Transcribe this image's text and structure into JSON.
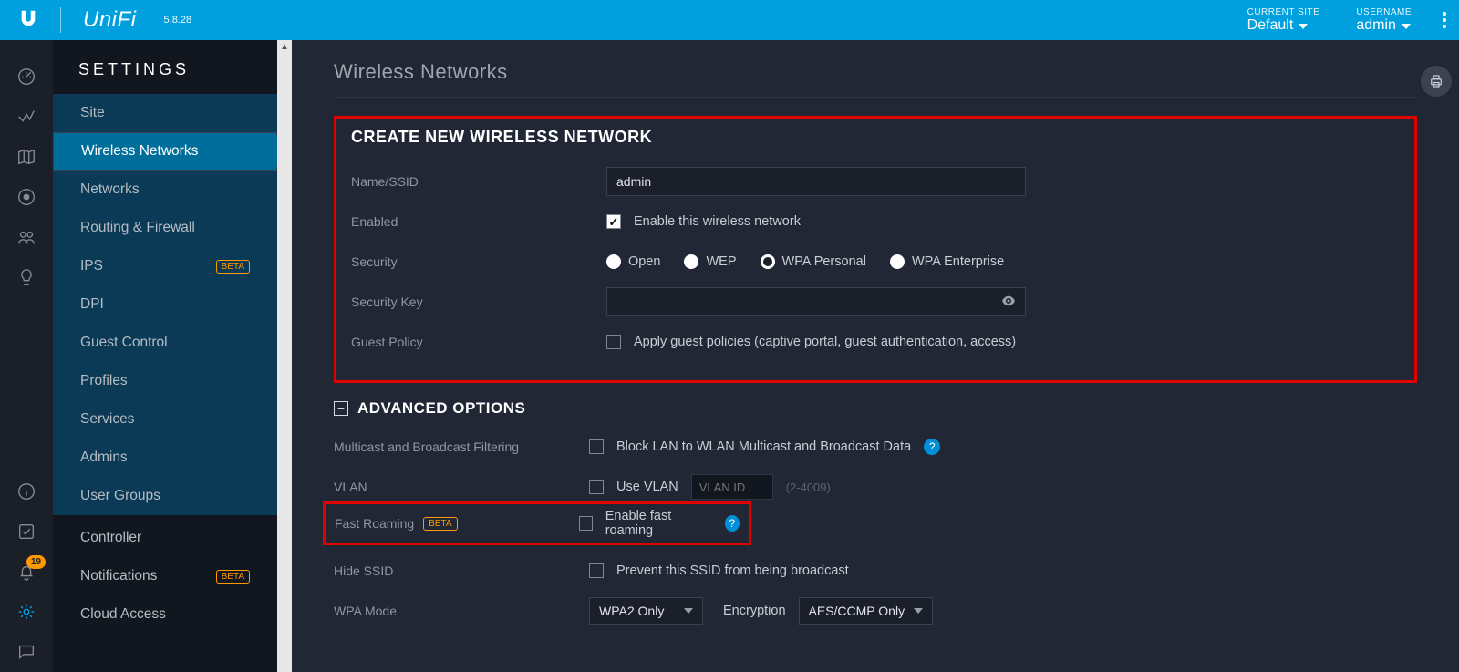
{
  "topbar": {
    "brand": "UniFi",
    "version": "5.8.28",
    "site_label": "CURRENT SITE",
    "site_value": "Default",
    "user_label": "USERNAME",
    "user_value": "admin"
  },
  "left_icons": {
    "notification_count": "19"
  },
  "sidebar": {
    "title": "SETTINGS",
    "items": [
      {
        "label": "Site"
      },
      {
        "label": "Wireless Networks"
      },
      {
        "label": "Networks"
      },
      {
        "label": "Routing & Firewall"
      },
      {
        "label": "IPS",
        "beta": "BETA"
      },
      {
        "label": "DPI"
      },
      {
        "label": "Guest Control"
      },
      {
        "label": "Profiles"
      },
      {
        "label": "Services"
      },
      {
        "label": "Admins"
      },
      {
        "label": "User Groups"
      },
      {
        "label": "Controller"
      },
      {
        "label": "Notifications",
        "beta": "BETA"
      },
      {
        "label": "Cloud Access"
      }
    ]
  },
  "page": {
    "title": "Wireless Networks",
    "panel_title": "CREATE NEW WIRELESS NETWORK",
    "fields": {
      "name_label": "Name/SSID",
      "name_value": "admin",
      "enabled_label": "Enabled",
      "enabled_text": "Enable this wireless network",
      "security_label": "Security",
      "sec_open": "Open",
      "sec_wep": "WEP",
      "sec_wpap": "WPA Personal",
      "sec_wpae": "WPA Enterprise",
      "seckey_label": "Security Key",
      "guest_label": "Guest Policy",
      "guest_text": "Apply guest policies (captive portal, guest authentication, access)"
    },
    "advanced": {
      "heading": "ADVANCED OPTIONS",
      "multicast_label": "Multicast and Broadcast Filtering",
      "multicast_text": "Block LAN to WLAN Multicast and Broadcast Data",
      "vlan_label": "VLAN",
      "vlan_text": "Use VLAN",
      "vlan_placeholder": "VLAN ID",
      "vlan_hint": "(2-4009)",
      "fast_label": "Fast Roaming",
      "fast_beta": "BETA",
      "fast_text": "Enable fast roaming",
      "hide_label": "Hide SSID",
      "hide_text": "Prevent this SSID from being broadcast",
      "wpa_label": "WPA Mode",
      "wpa_val": "WPA2 Only",
      "enc_label": "Encryption",
      "enc_val": "AES/CCMP Only"
    }
  }
}
